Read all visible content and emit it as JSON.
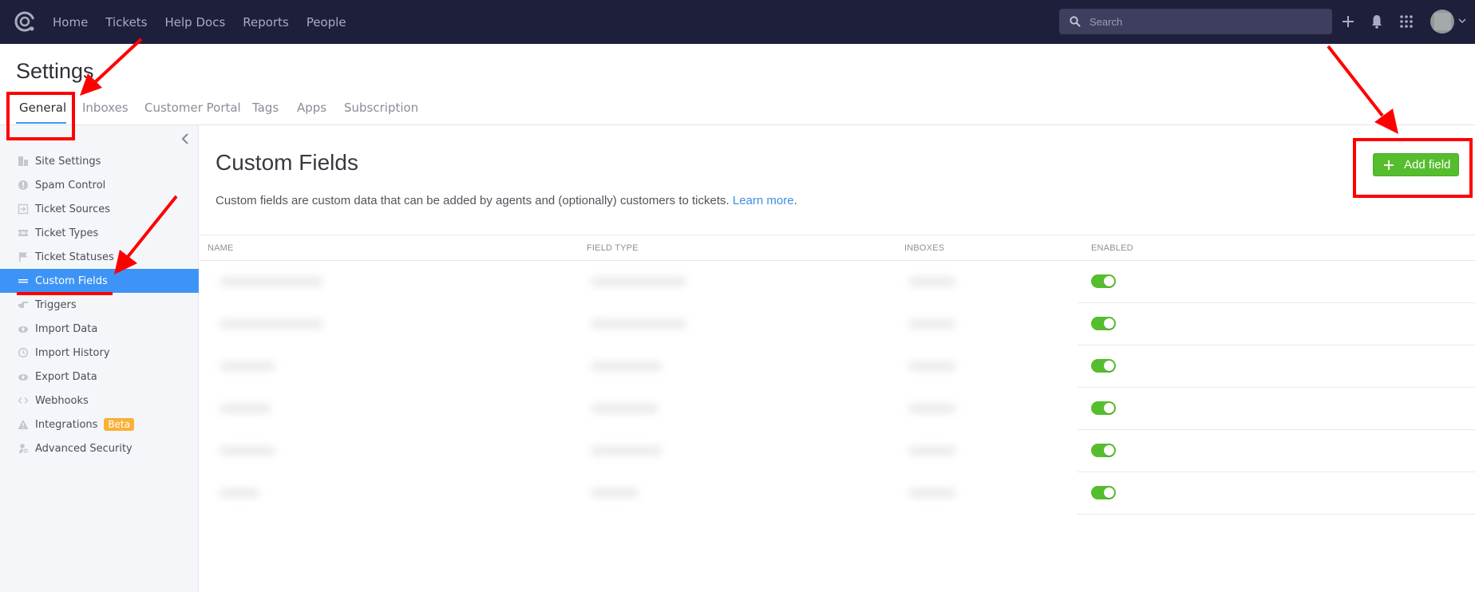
{
  "topnav": {
    "logo": "helpdesk-logo",
    "links": [
      "Home",
      "Tickets",
      "Help Docs",
      "Reports",
      "People"
    ],
    "search_placeholder": "Search",
    "icons": [
      "plus-icon",
      "bell-icon",
      "apps-grid-icon"
    ]
  },
  "page": {
    "title": "Settings",
    "tabs": [
      "General",
      "Inboxes",
      "Customer Portal",
      "Tags",
      "Apps",
      "Subscription"
    ],
    "active_tab": "General"
  },
  "sidebar": {
    "items": [
      {
        "label": "Site Settings",
        "icon": "building-icon"
      },
      {
        "label": "Spam Control",
        "icon": "alert-circle-icon"
      },
      {
        "label": "Ticket Sources",
        "icon": "sign-in-icon"
      },
      {
        "label": "Ticket Types",
        "icon": "ticket-icon"
      },
      {
        "label": "Ticket Statuses",
        "icon": "flag-icon"
      },
      {
        "label": "Custom Fields",
        "icon": "bars-icon",
        "active": true
      },
      {
        "label": "Triggers",
        "icon": "hand-point-icon"
      },
      {
        "label": "Import Data",
        "icon": "cloud-upload-icon"
      },
      {
        "label": "Import History",
        "icon": "history-icon"
      },
      {
        "label": "Export Data",
        "icon": "cloud-upload-icon"
      },
      {
        "label": "Webhooks",
        "icon": "code-icon"
      },
      {
        "label": "Integrations",
        "icon": "warning-icon",
        "badge": "Beta"
      },
      {
        "label": "Advanced Security",
        "icon": "user-key-icon"
      }
    ]
  },
  "main": {
    "title": "Custom Fields",
    "description": "Custom fields are custom data that can be added by agents and (optionally) customers to tickets.",
    "learn_more": "Learn more",
    "period": ".",
    "add_button": "Add field",
    "table": {
      "headers": [
        "NAME",
        "FIELD TYPE",
        "INBOXES",
        "ENABLED"
      ],
      "rows": [
        {
          "enabled": true
        },
        {
          "enabled": true
        },
        {
          "enabled": true
        },
        {
          "enabled": true
        },
        {
          "enabled": true
        },
        {
          "enabled": true
        }
      ]
    }
  },
  "colors": {
    "nav_bg": "#1e1f3a",
    "accent_blue": "#3d94f6",
    "success_green": "#56bd2e",
    "badge_orange": "#f9b138",
    "annotation_red": "#ff0000"
  }
}
